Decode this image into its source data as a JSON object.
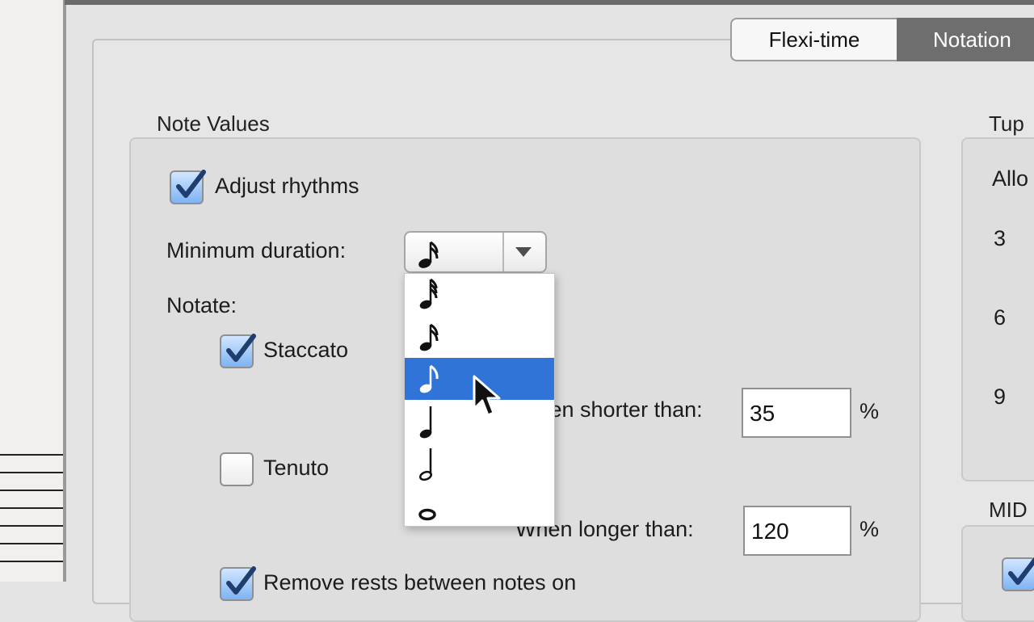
{
  "tabs": [
    {
      "label": "Flexi-time"
    },
    {
      "label": "Notation"
    }
  ],
  "note_values": {
    "title": "Note Values",
    "adjust_rhythms": {
      "label": "Adjust rhythms",
      "checked": true
    },
    "minimum_duration": {
      "label": "Minimum duration:",
      "selected_icon": "sixteenth-note-icon",
      "options": [
        {
          "icon": "thirty-second-note-icon"
        },
        {
          "icon": "sixteenth-note-icon"
        },
        {
          "icon": "eighth-note-icon",
          "highlighted": true
        },
        {
          "icon": "quarter-note-icon"
        },
        {
          "icon": "half-note-icon"
        },
        {
          "icon": "whole-note-icon"
        }
      ]
    },
    "notate_label": "Notate:",
    "staccato": {
      "label": "Staccato",
      "checked": true
    },
    "staccato_threshold": {
      "label": "When shorter than:",
      "value": "35",
      "unit": "%"
    },
    "tenuto": {
      "label": "Tenuto",
      "checked": false
    },
    "tenuto_threshold": {
      "label": "When longer than:",
      "value": "120",
      "unit": "%"
    },
    "remove_rests": {
      "label": "Remove rests between notes on",
      "checked": true
    }
  },
  "tuplets": {
    "title": "Tup",
    "allow_label": "Allo",
    "values": [
      "3",
      "6",
      "9"
    ]
  },
  "midi": {
    "title": "MID"
  },
  "colors": {
    "selection": "#2f74d6",
    "checkbox_fill": "#7eb3f3",
    "active_tab": "#6e6e6e"
  }
}
